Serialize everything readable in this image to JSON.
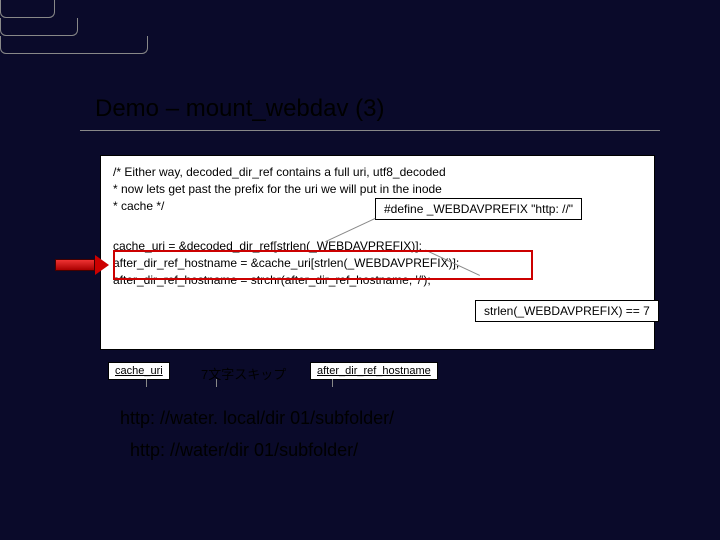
{
  "title": "Demo – mount_webdav (3)",
  "comment": {
    "line1": "/* Either way, decoded_dir_ref contains a full uri, utf8_decoded",
    "line2": " * now lets get past the prefix for the uri we will put in the inode",
    "line3": " * cache */"
  },
  "code": {
    "line1": "cache_uri = &decoded_dir_ref[strlen(_WEBDAVPREFIX)];",
    "line2": "after_dir_ref_hostname = &cache_uri[strlen(_WEBDAVPREFIX)];",
    "line3": "after_dir_ref_hostname = strchr(after_dir_ref_hostname, '/');"
  },
  "callouts": {
    "define": "#define _WEBDAVPREFIX \"http: //\"",
    "strlen": "strlen(_WEBDAVPREFIX) == 7"
  },
  "labels": {
    "cache_uri": "cache_uri",
    "skip": "7文字スキップ",
    "after": "after_dir_ref_hostname"
  },
  "urls": {
    "url1": "http: //water. local/dir 01/subfolder/",
    "url2": "http: //water/dir 01/subfolder/"
  }
}
